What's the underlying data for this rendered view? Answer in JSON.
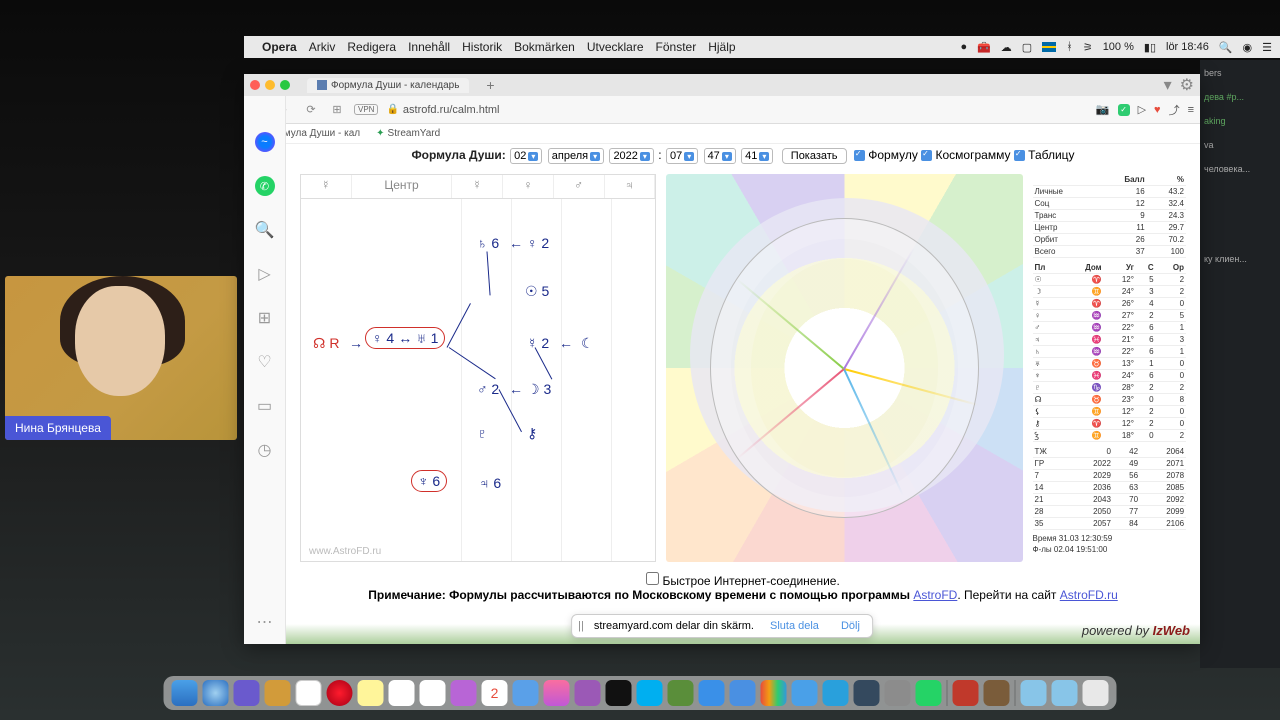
{
  "menubar": {
    "app": "Opera",
    "items": [
      "Arkiv",
      "Redigera",
      "Innehåll",
      "Historik",
      "Bokmärken",
      "Utvecklare",
      "Fönster",
      "Hjälp"
    ],
    "battery": "100 %",
    "clock": "lör 18:46"
  },
  "browser": {
    "tab_title": "Формула Души - календарь",
    "url": "astrofd.ru/calm.html",
    "bookmarks": [
      "Формула Души - кал",
      "StreamYard"
    ]
  },
  "controls": {
    "label": "Формула Души:",
    "day": "02",
    "month": "апреля",
    "year": "2022",
    "hour": "07",
    "min": "47",
    "sec": "41",
    "show_btn": "Показать",
    "opt_formula": "Формулу",
    "opt_cosmo": "Космограмму",
    "opt_table": "Таблицу"
  },
  "formula": {
    "center_label": "Центр",
    "watermark": "www.AstroFD.ru",
    "nodes": {
      "saturn": "♄ 6",
      "venus2": "♀ 2",
      "sun": "☉ 5",
      "node_r": "☊ R",
      "venus4": "♀ 4",
      "uranus": "♅ 1",
      "mercury2": "☿ 2",
      "lilith": "☾",
      "mars": "♂ 2",
      "moon": "☽ 3",
      "pluto": "♇",
      "chiron": "⚷",
      "neptune": "♆ 6",
      "jupiter": "♃ 6"
    }
  },
  "stats": {
    "headers": [
      "",
      "Балл",
      "%"
    ],
    "rows": [
      [
        "Личные",
        "16",
        "43.2"
      ],
      [
        "Соц",
        "12",
        "32.4"
      ],
      [
        "Транс",
        "9",
        "24.3"
      ],
      [
        "Центр",
        "11",
        "29.7"
      ],
      [
        "Орбит",
        "26",
        "70.2"
      ],
      [
        "Всего",
        "37",
        "100"
      ]
    ],
    "planet_headers": [
      "Пл",
      "Дом",
      "Уг",
      "С",
      "Ор"
    ],
    "planet_rows": [
      [
        "☉",
        "♈",
        "12°",
        "5",
        "2"
      ],
      [
        "☽",
        "♊",
        "24°",
        "3",
        "2"
      ],
      [
        "☿",
        "♈",
        "26°",
        "4",
        "0"
      ],
      [
        "♀",
        "♒",
        "27°",
        "2",
        "5"
      ],
      [
        "♂",
        "♒",
        "22°",
        "6",
        "1"
      ],
      [
        "♃",
        "♓",
        "21°",
        "6",
        "3"
      ],
      [
        "♄",
        "♒",
        "22°",
        "6",
        "1"
      ],
      [
        "♅",
        "♉",
        "13°",
        "1",
        "0"
      ],
      [
        "♆",
        "♓",
        "24°",
        "6",
        "0"
      ],
      [
        "♇",
        "♑",
        "28°",
        "2",
        "2"
      ],
      [
        "☊",
        "♉",
        "23°",
        "0",
        "8"
      ],
      [
        "⚸",
        "♊",
        "12°",
        "2",
        "0"
      ],
      [
        "⚷",
        "♈",
        "12°",
        "2",
        "0"
      ],
      [
        "Ꝣ",
        "♊",
        "18°",
        "0",
        "2"
      ]
    ],
    "dates_rows": [
      [
        "ТЖ",
        "0",
        "42",
        "2064"
      ],
      [
        "ГР",
        "2022",
        "49",
        "2071"
      ],
      [
        "7",
        "2029",
        "56",
        "2078"
      ],
      [
        "14",
        "2036",
        "63",
        "2085"
      ],
      [
        "21",
        "2043",
        "70",
        "2092"
      ],
      [
        "28",
        "2050",
        "77",
        "2099"
      ],
      [
        "35",
        "2057",
        "84",
        "2106"
      ]
    ],
    "time": "Время 31.03 12:30:59",
    "fdate": "Ф-лы 02.04 19:51:00"
  },
  "footer": {
    "fast": "Быстрое Интернет-соединение.",
    "note_prefix": "Примечание: Формулы рассчитываются по Московскому времени с помощью программы ",
    "link1": "AstroFD",
    "note_mid": ". Перейти на сайт ",
    "link2": "AstroFD.ru",
    "powered_pre": "powered by ",
    "powered_brand": "IzWeb"
  },
  "sharebar": {
    "msg": "streamyard.com delar din skärm.",
    "stop": "Sluta dela",
    "hide": "Dölj"
  },
  "webcam": {
    "name": "Нина Брянцева"
  },
  "rightpanel": {
    "items": [
      "bers",
      "дева #р...",
      "aking",
      "va",
      "человека...",
      "ку клиен..."
    ]
  }
}
